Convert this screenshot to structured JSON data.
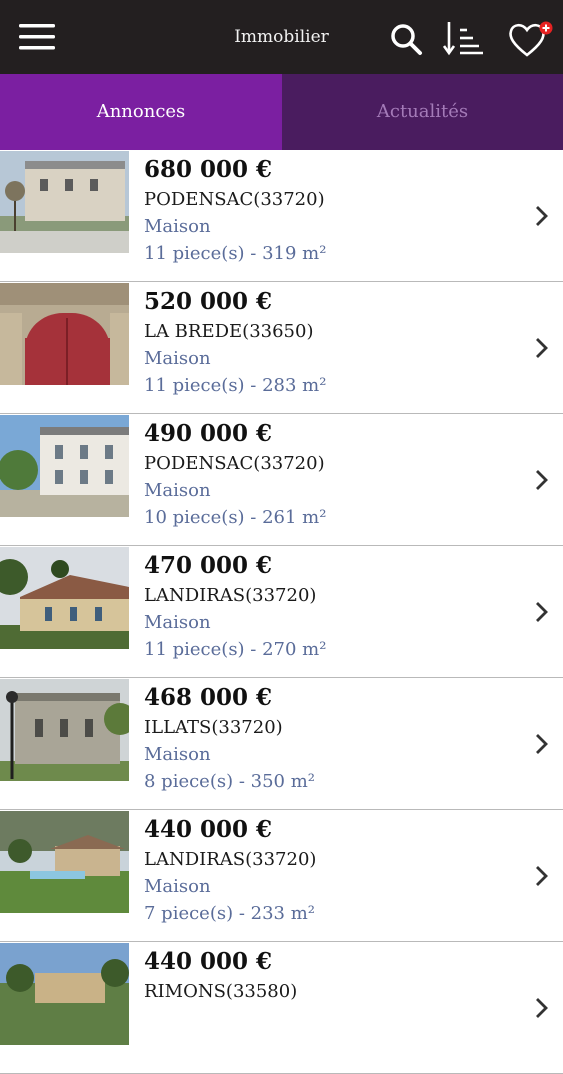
{
  "header": {
    "title": "Immobilier",
    "icons": [
      "menu-icon",
      "search-icon",
      "sort-icon",
      "favorites-heart-icon"
    ]
  },
  "tabs": [
    {
      "label": "Annonces",
      "active": true
    },
    {
      "label": "Actualités",
      "active": false
    }
  ],
  "colors": {
    "topbar": "#231f20",
    "tab_active": "#7b1fa1",
    "tab_inactive": "#4a1c5f",
    "secondary_text": "#5a6c99"
  },
  "listings": [
    {
      "price": "680 000 €",
      "city": "PODENSAC(33720)",
      "type": "Maison",
      "details": "11 piece(s) - 319 m²"
    },
    {
      "price": "520 000 €",
      "city": "LA BREDE(33650)",
      "type": "Maison",
      "details": "11 piece(s) - 283 m²"
    },
    {
      "price": "490 000 €",
      "city": "PODENSAC(33720)",
      "type": "Maison",
      "details": "10 piece(s) - 261 m²"
    },
    {
      "price": "470 000 €",
      "city": "LANDIRAS(33720)",
      "type": "Maison",
      "details": "11 piece(s) - 270 m²"
    },
    {
      "price": "468 000 €",
      "city": "ILLATS(33720)",
      "type": "Maison",
      "details": "8 piece(s) - 350 m²"
    },
    {
      "price": "440 000 €",
      "city": "LANDIRAS(33720)",
      "type": "Maison",
      "details": "7 piece(s) - 233 m²"
    },
    {
      "price": "440 000 €",
      "city": "RIMONS(33580)",
      "type": "",
      "details": ""
    }
  ]
}
